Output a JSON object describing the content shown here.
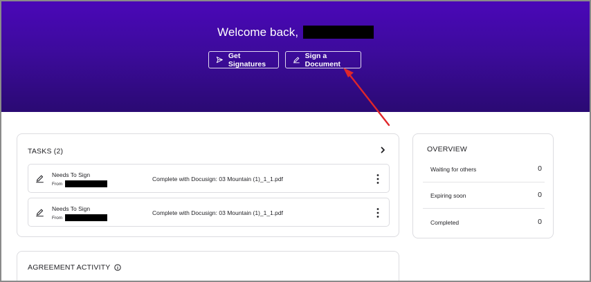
{
  "hero": {
    "welcome_text": "Welcome back,",
    "buttons": {
      "get_signatures": "Get Signatures",
      "sign_document": "Sign a Document"
    }
  },
  "tasks": {
    "title": "TASKS (2)",
    "items": [
      {
        "status": "Needs To Sign",
        "from_label": "From",
        "document": "Complete with Docusign: 03 Mountain (1)_1_1.pdf"
      },
      {
        "status": "Needs To Sign",
        "from_label": "From",
        "document": "Complete with Docusign: 03 Mountain (1)_1_1.pdf"
      }
    ]
  },
  "overview": {
    "title": "OVERVIEW",
    "rows": [
      {
        "label": "Waiting for others",
        "value": "0"
      },
      {
        "label": "Expiring soon",
        "value": "0"
      },
      {
        "label": "Completed",
        "value": "0"
      }
    ]
  },
  "agreement_activity": {
    "title": "AGREEMENT ACTIVITY"
  },
  "colors": {
    "hero_top": "#4a07b8",
    "hero_bottom": "#2a0a73",
    "annotation_arrow": "#e0262a"
  },
  "icons": [
    "send-icon",
    "pen-icon",
    "chevron-right-icon",
    "kebab-menu-icon",
    "info-icon"
  ]
}
